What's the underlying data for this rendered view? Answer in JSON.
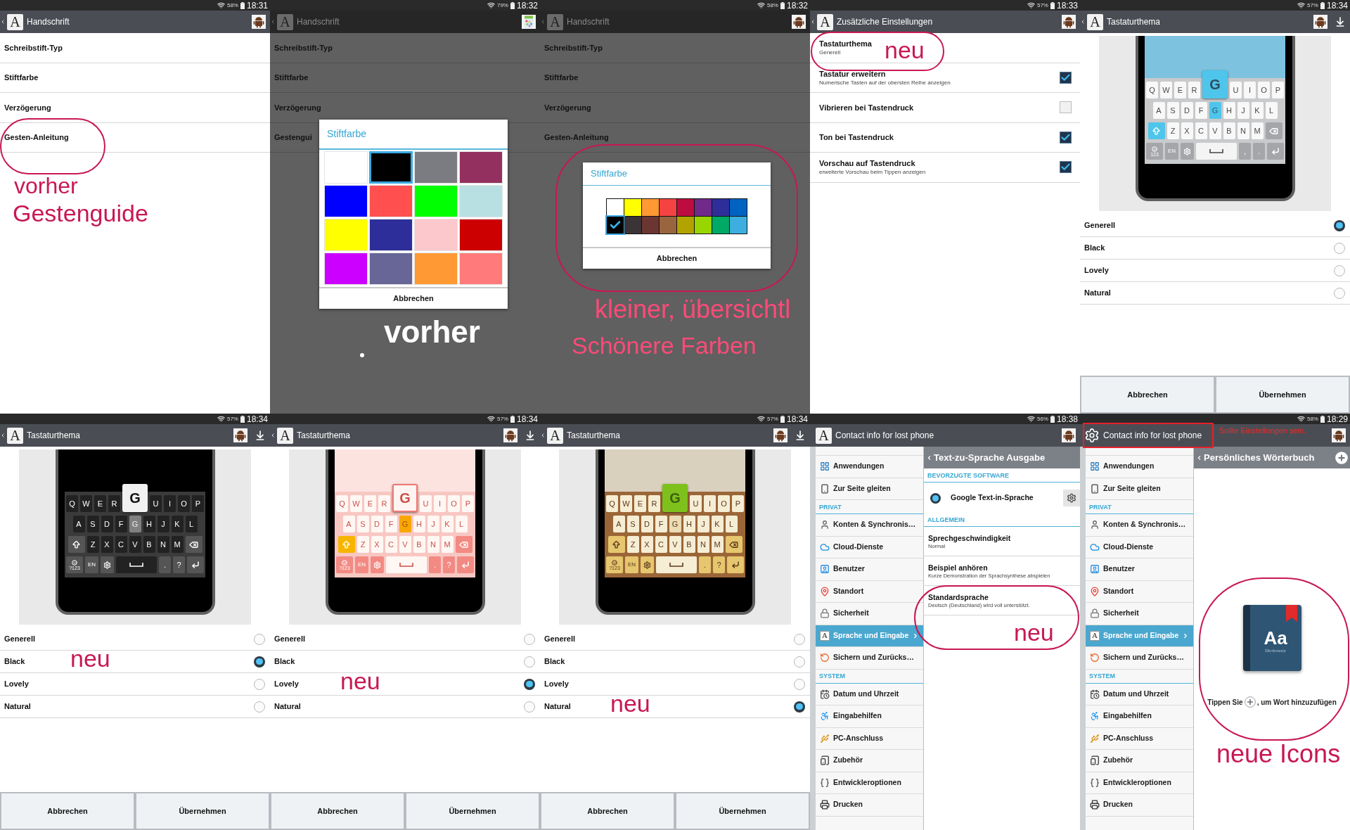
{
  "panels": [
    {
      "kind": "handwriting",
      "status": {
        "battery": "58%",
        "time": "18:31"
      },
      "bar": {
        "logo": "A",
        "title": "Handschrift"
      },
      "items": [
        "Schreibstift-Typ",
        "Stiftfarbe",
        "Verzögerung",
        "Gesten-Anleitung"
      ],
      "annotations": [
        {
          "text": "vorher",
          "color": "#c81852"
        },
        {
          "text": "Gestenguide",
          "color": "#c81852"
        }
      ]
    },
    {
      "kind": "handwriting",
      "status": {
        "battery": "79%",
        "time": "18:32"
      },
      "bar": {
        "logo": "A",
        "title": "Handschrift"
      },
      "items": [
        "Schreibstift-Typ",
        "Stiftfarbe",
        "Verzögerung",
        "Gestengui"
      ],
      "dialog": {
        "kind": "grid",
        "title": "Stiftfarbe",
        "colors": [
          {
            "color": "#ffffff",
            "selected": false
          },
          {
            "color": "#000000",
            "selected": true
          },
          {
            "color": "#7b7c81",
            "selected": false
          },
          {
            "color": "#94305f",
            "selected": false
          },
          {
            "color": "#0000ff",
            "selected": false
          },
          {
            "color": "#ff4f4f",
            "selected": false
          },
          {
            "color": "#00ff00",
            "selected": false
          },
          {
            "color": "#b8e0e2",
            "selected": false
          },
          {
            "color": "#ffff00",
            "selected": false
          },
          {
            "color": "#2e2e9a",
            "selected": false
          },
          {
            "color": "#fcc8cc",
            "selected": false
          },
          {
            "color": "#cc0000",
            "selected": false
          },
          {
            "color": "#cc00ff",
            "selected": false
          },
          {
            "color": "#676697",
            "selected": false
          },
          {
            "color": "#ff9933",
            "selected": false
          },
          {
            "color": "#ff7b7b",
            "selected": false
          }
        ],
        "button": "Abbrechen"
      },
      "annotations": [
        {
          "text": "vorher",
          "color": "#ffffff"
        }
      ]
    },
    {
      "kind": "handwriting",
      "status": {
        "battery": "58%",
        "time": "18:32"
      },
      "bar": {
        "logo": "A",
        "title": "Handschrift"
      },
      "items": [
        "Schreibstift-Typ",
        "Stiftfarbe",
        "Verzögerung",
        "Gesten-Anleitung"
      ],
      "dialog": {
        "kind": "strip",
        "title": "Stiftfarbe",
        "colors": [
          {
            "color": "#ffffff",
            "selected": false
          },
          {
            "color": "#ffff00",
            "selected": false
          },
          {
            "color": "#ff9933",
            "selected": false
          },
          {
            "color": "#f54242",
            "selected": false
          },
          {
            "color": "#bd0d40",
            "selected": false
          },
          {
            "color": "#6f2a8a",
            "selected": false
          },
          {
            "color": "#2e2e9a",
            "selected": false
          },
          {
            "color": "#0063c2",
            "selected": false
          },
          {
            "color": "#000000",
            "selected": true
          },
          {
            "color": "#3b3436",
            "selected": false
          },
          {
            "color": "#6b3532",
            "selected": false
          },
          {
            "color": "#98653f",
            "selected": false
          },
          {
            "color": "#b3a300",
            "selected": false
          },
          {
            "color": "#99d500",
            "selected": false
          },
          {
            "color": "#00aa66",
            "selected": false
          },
          {
            "color": "#3eaee0",
            "selected": false
          }
        ],
        "button": "Abbrechen"
      },
      "annotations": [
        {
          "text": "kleiner, übersichtl",
          "color": "#ff4a78"
        },
        {
          "text": "Schönere Farben",
          "color": "#ff4a78"
        }
      ]
    },
    {
      "kind": "keyboard_options",
      "status": {
        "battery": "57%",
        "time": "18:33"
      },
      "bar": {
        "logo": "A",
        "title": "Zusätzliche Einstellungen"
      },
      "items": [
        {
          "kind": "link",
          "title": "Tastaturthema",
          "subtitle": "Generell"
        },
        {
          "kind": "toggle",
          "title": "Tastatur erweitern",
          "subtitle": "Numerische Tasten auf der obersten Reihe anzeigen",
          "checked": true
        },
        {
          "kind": "toggle",
          "title": "Vibrieren bei Tastendruck",
          "checked": false
        },
        {
          "kind": "toggle",
          "title": "Ton bei Tastendruck",
          "checked": true
        },
        {
          "kind": "toggle",
          "title": "Vorschau auf Tastendruck",
          "subtitle": "erweiterte Vorschau beim Tippen anzeigen",
          "checked": true
        }
      ],
      "annotations": [
        {
          "text": "neu",
          "color": "#c81852"
        }
      ]
    },
    {
      "kind": "keyboard_theme",
      "status": {
        "battery": "57%",
        "time": "18:34"
      },
      "bar": {
        "logo": "A",
        "title": "Tastaturthema"
      },
      "preview": {
        "kind": "generell",
        "top_row": {
          "before": [
            "Q",
            "W",
            "E",
            "R"
          ],
          "popup": "G",
          "after": [
            "U",
            "I",
            "O",
            "P"
          ]
        },
        "home_row": {
          "before": [
            "A",
            "S",
            "D",
            "F"
          ],
          "pressed": "G",
          "after": [
            "H",
            "J",
            "K",
            "L"
          ]
        },
        "lower_row": [
          "Z",
          "X",
          "C",
          "V",
          "B",
          "N",
          "M"
        ],
        "symbols": "123",
        "language": "EN",
        "punctuation": [
          ",",
          "."
        ]
      },
      "options": [
        {
          "label": "Generell",
          "selected": true
        },
        {
          "label": "Black",
          "selected": false
        },
        {
          "label": "Lovely",
          "selected": false
        },
        {
          "label": "Natural",
          "selected": false
        }
      ],
      "buttons": [
        "Abbrechen",
        "Übernehmen"
      ]
    },
    {
      "kind": "keyboard_theme",
      "status": {
        "battery": "57%",
        "time": "18:34"
      },
      "bar": {
        "logo": "A",
        "title": "Tastaturthema"
      },
      "preview": {
        "kind": "black",
        "top_row": {
          "before": [
            "Q",
            "W",
            "E",
            "R"
          ],
          "popup": "G",
          "after": [
            "U",
            "I",
            "O",
            "P"
          ]
        },
        "home_row": {
          "before": [
            "A",
            "S",
            "D",
            "F"
          ],
          "pressed": "G",
          "after": [
            "H",
            "J",
            "K",
            "L"
          ]
        },
        "lower_row": [
          "Z",
          "X",
          "C",
          "V",
          "B",
          "N",
          "M"
        ],
        "symbols": "?123",
        "language": "EN",
        "punctuation": [
          ".",
          "?"
        ]
      },
      "options": [
        {
          "label": "Generell",
          "selected": false
        },
        {
          "label": "Black",
          "selected": true,
          "note": {
            "text": "neu",
            "color": "#c81852"
          }
        },
        {
          "label": "Lovely",
          "selected": false
        },
        {
          "label": "Natural",
          "selected": false
        }
      ],
      "buttons": [
        "Abbrechen",
        "Übernehmen"
      ]
    },
    {
      "kind": "keyboard_theme",
      "status": {
        "battery": "57%",
        "time": "18:34"
      },
      "bar": {
        "logo": "A",
        "title": "Tastaturthema"
      },
      "preview": {
        "kind": "lovely",
        "top_row": {
          "before": [
            "Q",
            "W",
            "E",
            "R"
          ],
          "popup": "G",
          "after": [
            "U",
            "I",
            "O",
            "P"
          ]
        },
        "home_row": {
          "before": [
            "A",
            "S",
            "D",
            "F"
          ],
          "pressed": "G",
          "after": [
            "H",
            "J",
            "K",
            "L"
          ]
        },
        "lower_row": [
          "Z",
          "X",
          "C",
          "V",
          "B",
          "N",
          "M"
        ],
        "symbols": "?123",
        "language": "EN",
        "punctuation": [
          ".",
          "?"
        ]
      },
      "options": [
        {
          "label": "Generell",
          "selected": false
        },
        {
          "label": "Black",
          "selected": false
        },
        {
          "label": "Lovely",
          "selected": true,
          "note": {
            "text": "neu",
            "color": "#c81852"
          }
        },
        {
          "label": "Natural",
          "selected": false
        }
      ],
      "buttons": [
        "Abbrechen",
        "Übernehmen"
      ]
    },
    {
      "kind": "keyboard_theme",
      "status": {
        "battery": "57%",
        "time": "18:34"
      },
      "bar": {
        "logo": "A",
        "title": "Tastaturthema"
      },
      "preview": {
        "kind": "natural",
        "top_row": {
          "before": [
            "Q",
            "W",
            "E",
            "R"
          ],
          "popup": "G",
          "after": [
            "U",
            "I",
            "O",
            "P"
          ]
        },
        "home_row": {
          "before": [
            "A",
            "S",
            "D",
            "F"
          ],
          "pressed": "G",
          "after": [
            "H",
            "J",
            "K",
            "L"
          ]
        },
        "lower_row": [
          "Z",
          "X",
          "C",
          "V",
          "B",
          "N",
          "M"
        ],
        "symbols": "?123",
        "language": "EN",
        "punctuation": [
          ".",
          "?"
        ]
      },
      "options": [
        {
          "label": "Generell",
          "selected": false
        },
        {
          "label": "Black",
          "selected": false
        },
        {
          "label": "Lovely",
          "selected": false
        },
        {
          "label": "Natural",
          "selected": true,
          "note": {
            "text": "neu",
            "color": "#c81852"
          }
        }
      ],
      "buttons": [
        "Abbrechen",
        "Übernehmen"
      ]
    },
    {
      "kind": "settings",
      "status": {
        "battery": "56%",
        "time": "18:38"
      },
      "bar": {
        "logo": "A",
        "title": "Contact info for lost phone"
      },
      "menu": [
        {
          "kind": "item",
          "label": "Anwendungen",
          "selected": false
        },
        {
          "kind": "item",
          "label": "Zur Seite gleiten",
          "selected": false
        },
        {
          "kind": "header",
          "label": "PRIVAT"
        },
        {
          "kind": "item",
          "label": "Konten & Synchronis…",
          "selected": false
        },
        {
          "kind": "item",
          "label": "Cloud-Dienste",
          "selected": false
        },
        {
          "kind": "item",
          "label": "Benutzer",
          "selected": false
        },
        {
          "kind": "item",
          "label": "Standort",
          "selected": false
        },
        {
          "kind": "item",
          "label": "Sicherheit",
          "selected": false
        },
        {
          "kind": "item",
          "label": "Sprache und Eingabe",
          "selected": true,
          "logo": "A"
        },
        {
          "kind": "item",
          "label": "Sichern und Zurücks…",
          "selected": false
        },
        {
          "kind": "header",
          "label": "SYSTEM"
        },
        {
          "kind": "item",
          "label": "Datum und Uhrzeit",
          "selected": false
        },
        {
          "kind": "item",
          "label": "Eingabehilfen",
          "selected": false
        },
        {
          "kind": "item",
          "label": "PC-Anschluss",
          "selected": false
        },
        {
          "kind": "item",
          "label": "Zubehör",
          "selected": false
        },
        {
          "kind": "item",
          "label": "Entwickleroptionen",
          "selected": false
        },
        {
          "kind": "item",
          "label": "Drucken",
          "selected": false
        }
      ],
      "detail": {
        "kind": "tts",
        "title": "Text-zu-Sprache Ausgabe",
        "sections": [
          {
            "heading": "BEVORZUGTE SOFTWARE",
            "rows": [
              {
                "kind": "engine",
                "title": "Google Text-in-Sprache",
                "selected": true
              }
            ]
          },
          {
            "heading": "ALLGEMEIN",
            "rows": [
              {
                "kind": "text",
                "title": "Sprechgeschwindigkeit",
                "subtitle": "Normal"
              },
              {
                "kind": "text",
                "title": "Beispiel anhören",
                "subtitle": "Kurze Demonstration der Sprachsynthese abspielen"
              },
              {
                "kind": "text",
                "title": "Standardsprache",
                "subtitle": "Deutsch (Deutschland) wird voll unterstützt."
              }
            ]
          }
        ]
      },
      "annotations": [
        {
          "text": "neu",
          "color": "#c81852"
        }
      ]
    },
    {
      "kind": "settings",
      "status": {
        "battery": "58%",
        "time": "18:29"
      },
      "bar": {
        "title": "Contact info for lost phone"
      },
      "menu": [
        {
          "kind": "item",
          "label": "Anwendungen",
          "selected": false
        },
        {
          "kind": "item",
          "label": "Zur Seite gleiten",
          "selected": false
        },
        {
          "kind": "header",
          "label": "PRIVAT"
        },
        {
          "kind": "item",
          "label": "Konten & Synchronis…",
          "selected": false
        },
        {
          "kind": "item",
          "label": "Cloud-Dienste",
          "selected": false
        },
        {
          "kind": "item",
          "label": "Benutzer",
          "selected": false
        },
        {
          "kind": "item",
          "label": "Standort",
          "selected": false
        },
        {
          "kind": "item",
          "label": "Sicherheit",
          "selected": false
        },
        {
          "kind": "item",
          "label": "Sprache und Eingabe",
          "selected": true,
          "logo": "A"
        },
        {
          "kind": "item",
          "label": "Sichern und Zurücks…",
          "selected": false
        },
        {
          "kind": "header",
          "label": "SYSTEM"
        },
        {
          "kind": "item",
          "label": "Datum und Uhrzeit",
          "selected": false
        },
        {
          "kind": "item",
          "label": "Eingabehilfen",
          "selected": false
        },
        {
          "kind": "item",
          "label": "PC-Anschluss",
          "selected": false
        },
        {
          "kind": "item",
          "label": "Zubehör",
          "selected": false
        },
        {
          "kind": "item",
          "label": "Entwickleroptionen",
          "selected": false
        },
        {
          "kind": "item",
          "label": "Drucken",
          "selected": false
        }
      ],
      "detail": {
        "kind": "dictionary",
        "title": "Persönliches Wörterbuch",
        "book": {
          "title": "Aa",
          "subtitle": "Dictionary"
        },
        "hint_before": "Tippen Sie",
        "hint_after": ", um Wort hinzuzufügen"
      },
      "annotations": [
        {
          "text": "Sollte Einstellungen sein.",
          "color": "#ee2a2a"
        },
        {
          "text": "neue Icons",
          "color": "#c81852"
        }
      ]
    }
  ]
}
